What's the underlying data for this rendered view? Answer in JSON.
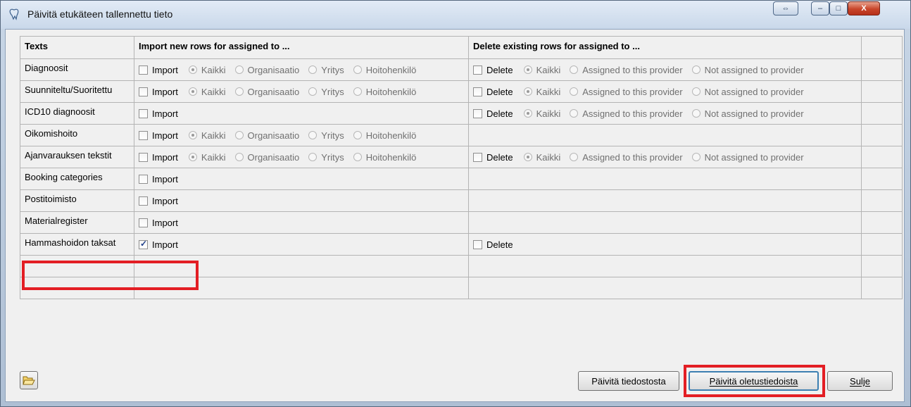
{
  "window": {
    "title": "Päivitä etukäteen tallennettu tieto",
    "restore_glyph": "⇔",
    "minimize_glyph": "–",
    "maximize_glyph": "□",
    "close_glyph": "X"
  },
  "grid": {
    "headers": {
      "texts": "Texts",
      "import": "Import new rows for assigned to ...",
      "delete": "Delete existing rows for assigned to ..."
    },
    "import_label": "Import",
    "delete_label": "Delete",
    "import_options": [
      "Kaikki",
      "Organisaatio",
      "Yritys",
      "Hoitohenkilö"
    ],
    "delete_options": [
      "Kaikki",
      "Assigned to this provider",
      "Not assigned to provider"
    ],
    "rows": [
      {
        "name": "Diagnoosit",
        "import_checked": false,
        "import_radios": true,
        "delete": true,
        "delete_checked": false,
        "delete_radios": true
      },
      {
        "name": "Suunniteltu/Suoritettu",
        "import_checked": false,
        "import_radios": true,
        "delete": true,
        "delete_checked": false,
        "delete_radios": true
      },
      {
        "name": "ICD10 diagnoosit",
        "import_checked": false,
        "import_radios": false,
        "delete": true,
        "delete_checked": false,
        "delete_radios": true
      },
      {
        "name": "Oikomishoito",
        "import_checked": false,
        "import_radios": true,
        "delete": false,
        "delete_checked": false,
        "delete_radios": false
      },
      {
        "name": "Ajanvarauksen tekstit",
        "import_checked": false,
        "import_radios": true,
        "delete": true,
        "delete_checked": false,
        "delete_radios": true
      },
      {
        "name": "Booking categories",
        "import_checked": false,
        "import_radios": false,
        "delete": false,
        "delete_checked": false,
        "delete_radios": false
      },
      {
        "name": "Postitoimisto",
        "import_checked": false,
        "import_radios": false,
        "delete": false,
        "delete_checked": false,
        "delete_radios": false
      },
      {
        "name": "Materialregister",
        "import_checked": false,
        "import_radios": false,
        "delete": false,
        "delete_checked": false,
        "delete_radios": false
      },
      {
        "name": "Hammashoidon taksat",
        "import_checked": true,
        "import_radios": false,
        "delete": true,
        "delete_checked": false,
        "delete_radios": false
      }
    ],
    "empty_rows": 2
  },
  "buttons": {
    "from_file": "Päivitä tiedostosta",
    "from_defaults": "Päivitä oletustiedoista",
    "close": "Sulje"
  },
  "colors": {
    "highlight": "#e31e24",
    "title_bar": "#c9d8ea",
    "close_button": "#c8452a"
  }
}
